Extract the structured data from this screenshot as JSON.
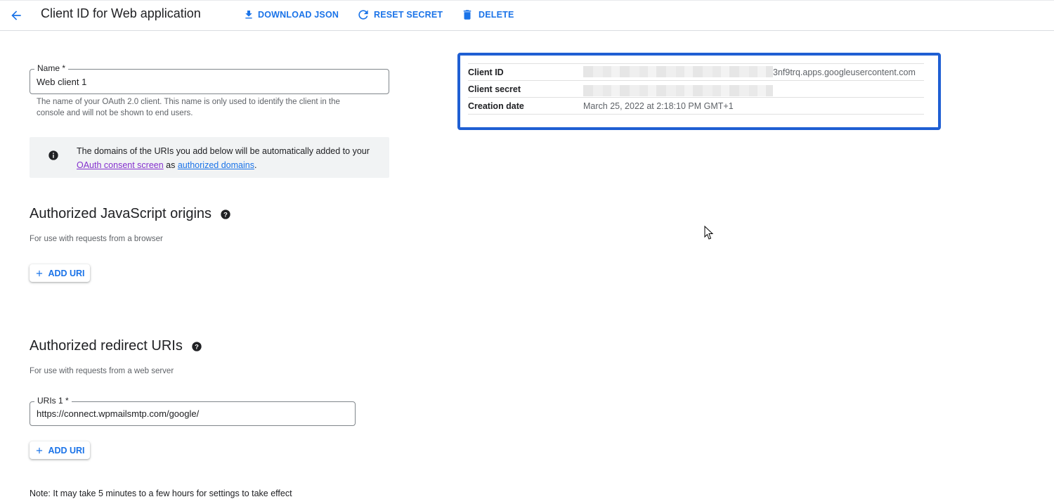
{
  "header": {
    "title": "Client ID for Web application",
    "actions": {
      "download": "DOWNLOAD JSON",
      "reset": "RESET SECRET",
      "delete": "DELETE"
    }
  },
  "name_field": {
    "label": "Name *",
    "value": "Web client 1",
    "helper": "The name of your OAuth 2.0 client. This name is only used to identify the client in the console and will not be shown to end users."
  },
  "info": {
    "text_before": "The domains of the URIs you add below will be automatically added to your ",
    "link_consent": "OAuth consent screen",
    "text_middle": " as ",
    "link_domains": "authorized domains",
    "text_after": "."
  },
  "js_origins": {
    "heading": "Authorized JavaScript origins",
    "subtitle": "For use with requests from a browser",
    "add_label": "ADD URI"
  },
  "redirect_uris": {
    "heading": "Authorized redirect URIs",
    "subtitle": "For use with requests from a web server",
    "field_label": "URIs 1 *",
    "field_value": "https://connect.wpmailsmtp.com/google/",
    "add_label": "ADD URI"
  },
  "note": "Note: It may take 5 minutes to a few hours for settings to take effect",
  "details": {
    "client_id_label": "Client ID",
    "client_id_visible_suffix": "3nf9trq.apps.googleusercontent.com",
    "client_secret_label": "Client secret",
    "creation_date_label": "Creation date",
    "creation_date_value": "March 25, 2022 at 2:18:10 PM GMT+1"
  },
  "colors": {
    "accent": "#1a73e8",
    "highlight_border": "#1f5fd3",
    "visited_link": "#8430ce"
  }
}
